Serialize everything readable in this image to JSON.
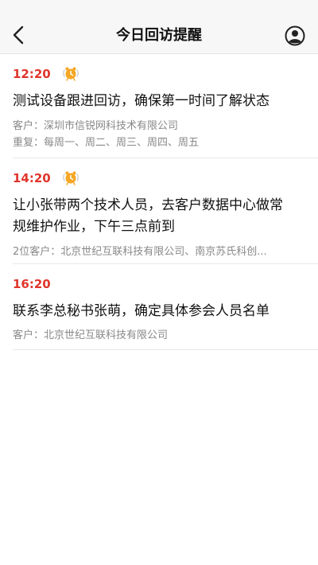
{
  "header": {
    "title": "今日回访提醒",
    "back_icon": "chevron-left-icon",
    "profile_icon": "user-circle-icon"
  },
  "colors": {
    "time_red": "#e0352b",
    "alarm_orange": "#f5a623",
    "meta_gray": "#888888"
  },
  "reminders": [
    {
      "time": "12:20",
      "has_alarm": true,
      "content_lines": [
        "测试设备跟进回访，确保第一时间了解状态"
      ],
      "customer": "客户：深圳市信锐网科技术有限公司",
      "repeat": "重复：每周一、周二、周三、周四、周五"
    },
    {
      "time": "14:20",
      "has_alarm": true,
      "content_lines": [
        "让小张带两个技术人员，去客户数据中心做常",
        "规维护作业，下午三点前到"
      ],
      "customer": "2位客户：北京世纪互联科技有限公司、南京苏氏科创..."
    },
    {
      "time": "16:20",
      "has_alarm": false,
      "content_lines": [
        "联系李总秘书张萌，确定具体参会人员名单"
      ],
      "customer": "客户：北京世纪互联科技有限公司"
    }
  ]
}
